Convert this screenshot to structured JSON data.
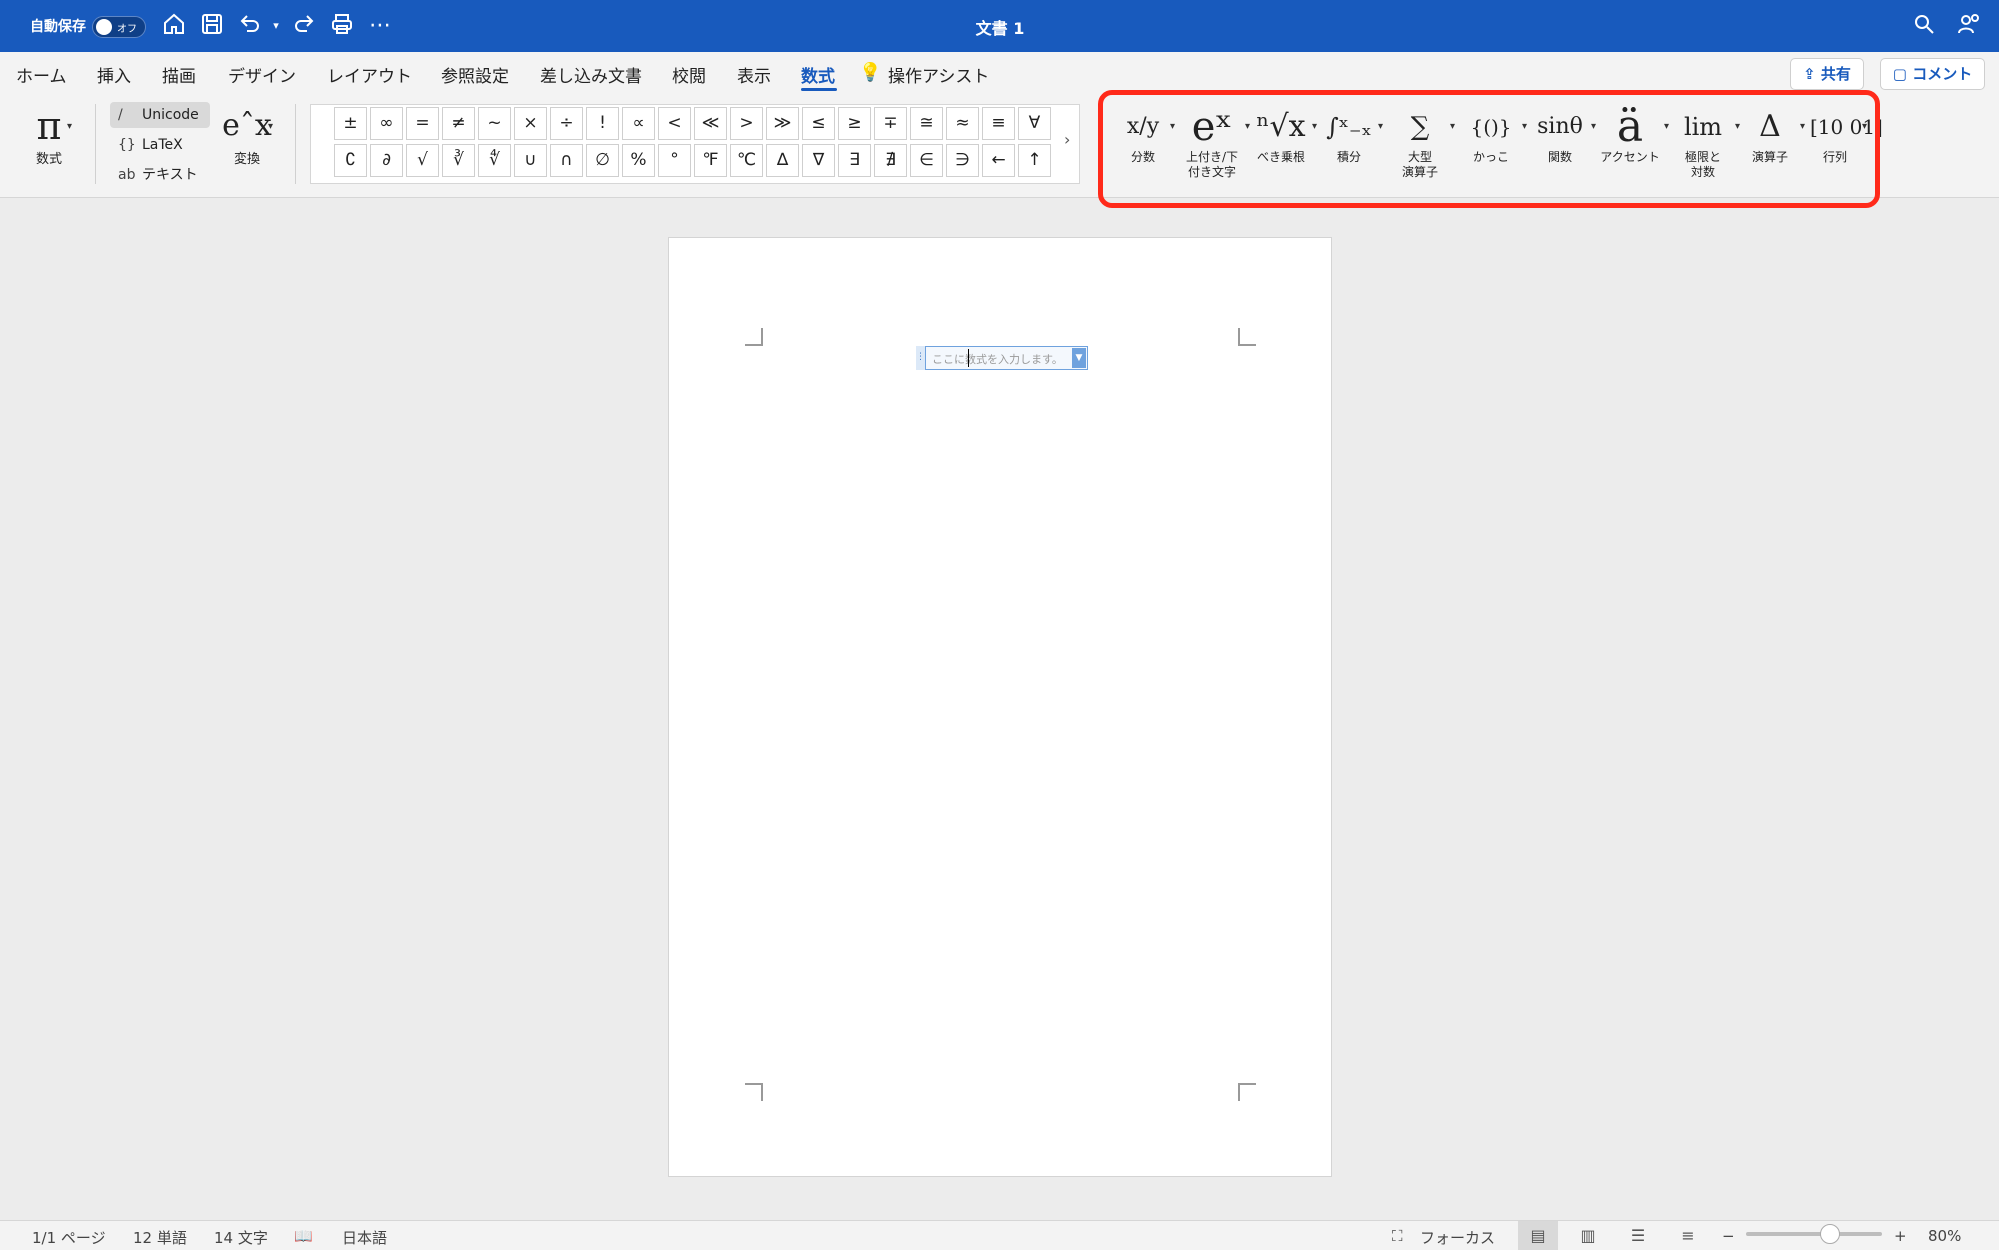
{
  "titlebar": {
    "autosave_label": "自動保存",
    "autosave_state": "オフ",
    "doc_title": "文書 1",
    "more_label": "⋯"
  },
  "tabs": [
    {
      "label": "ホーム"
    },
    {
      "label": "挿入"
    },
    {
      "label": "描画"
    },
    {
      "label": "デザイン"
    },
    {
      "label": "レイアウト"
    },
    {
      "label": "参照設定"
    },
    {
      "label": "差し込み文書"
    },
    {
      "label": "校閲"
    },
    {
      "label": "表示"
    },
    {
      "label": "数式",
      "active": true
    },
    {
      "label": "操作アシスト"
    }
  ],
  "actions": {
    "share_label": "共有",
    "comment_label": "コメント"
  },
  "ribbon": {
    "equation_label": "数式",
    "equation_glyph": "π",
    "modes": [
      {
        "icon": "/",
        "label": "Unicode",
        "selected": true
      },
      {
        "icon": "{}",
        "label": "LaTeX"
      },
      {
        "icon": "ab",
        "label": "テキスト"
      }
    ],
    "convert_label": "変換",
    "convert_glyph": "eˆx",
    "symbols_row1": [
      "±",
      "∞",
      "=",
      "≠",
      "~",
      "×",
      "÷",
      "!",
      "∝",
      "<",
      "≪",
      ">",
      "≫",
      "≤",
      "≥",
      "∓",
      "≅",
      "≈",
      "≡",
      "∀"
    ],
    "symbols_row2": [
      "∁",
      "∂",
      "√",
      "∛",
      "∜",
      "∪",
      "∩",
      "∅",
      "%",
      "°",
      "℉",
      "℃",
      "∆",
      "∇",
      "∃",
      "∄",
      "∈",
      "∋",
      "←",
      "↑"
    ],
    "more_symbols": "›",
    "structures": [
      {
        "glyph": "x/y",
        "label": "分数"
      },
      {
        "glyph": "eˣ",
        "label": "上付き/下\n付き文字"
      },
      {
        "glyph": "ⁿ√x",
        "label": "べき乗根"
      },
      {
        "glyph": "∫ˣ₋ₓ",
        "label": "積分"
      },
      {
        "glyph": "∑",
        "label": "大型\n演算子"
      },
      {
        "glyph": "{()}",
        "label": "かっこ"
      },
      {
        "glyph": "sinθ",
        "label": "関数"
      },
      {
        "glyph": "ä",
        "label": "アクセント"
      },
      {
        "glyph": "lim",
        "label": "極限と\n対数"
      },
      {
        "glyph": "Δ",
        "label": "演算子"
      },
      {
        "glyph": "[10 01]",
        "label": "行列"
      }
    ]
  },
  "document": {
    "equation_placeholder": "ここに数式を入力します。"
  },
  "statusbar": {
    "page": "1/1 ページ",
    "words": "12 単語",
    "chars": "14 文字",
    "language": "日本語",
    "focus_label": "フォーカス",
    "zoom_minus": "−",
    "zoom_plus": "+",
    "zoom_level": "80%",
    "zoom_fraction": 0.62
  },
  "colors": {
    "accent": "#185abd",
    "highlight": "#ff2a1a"
  }
}
